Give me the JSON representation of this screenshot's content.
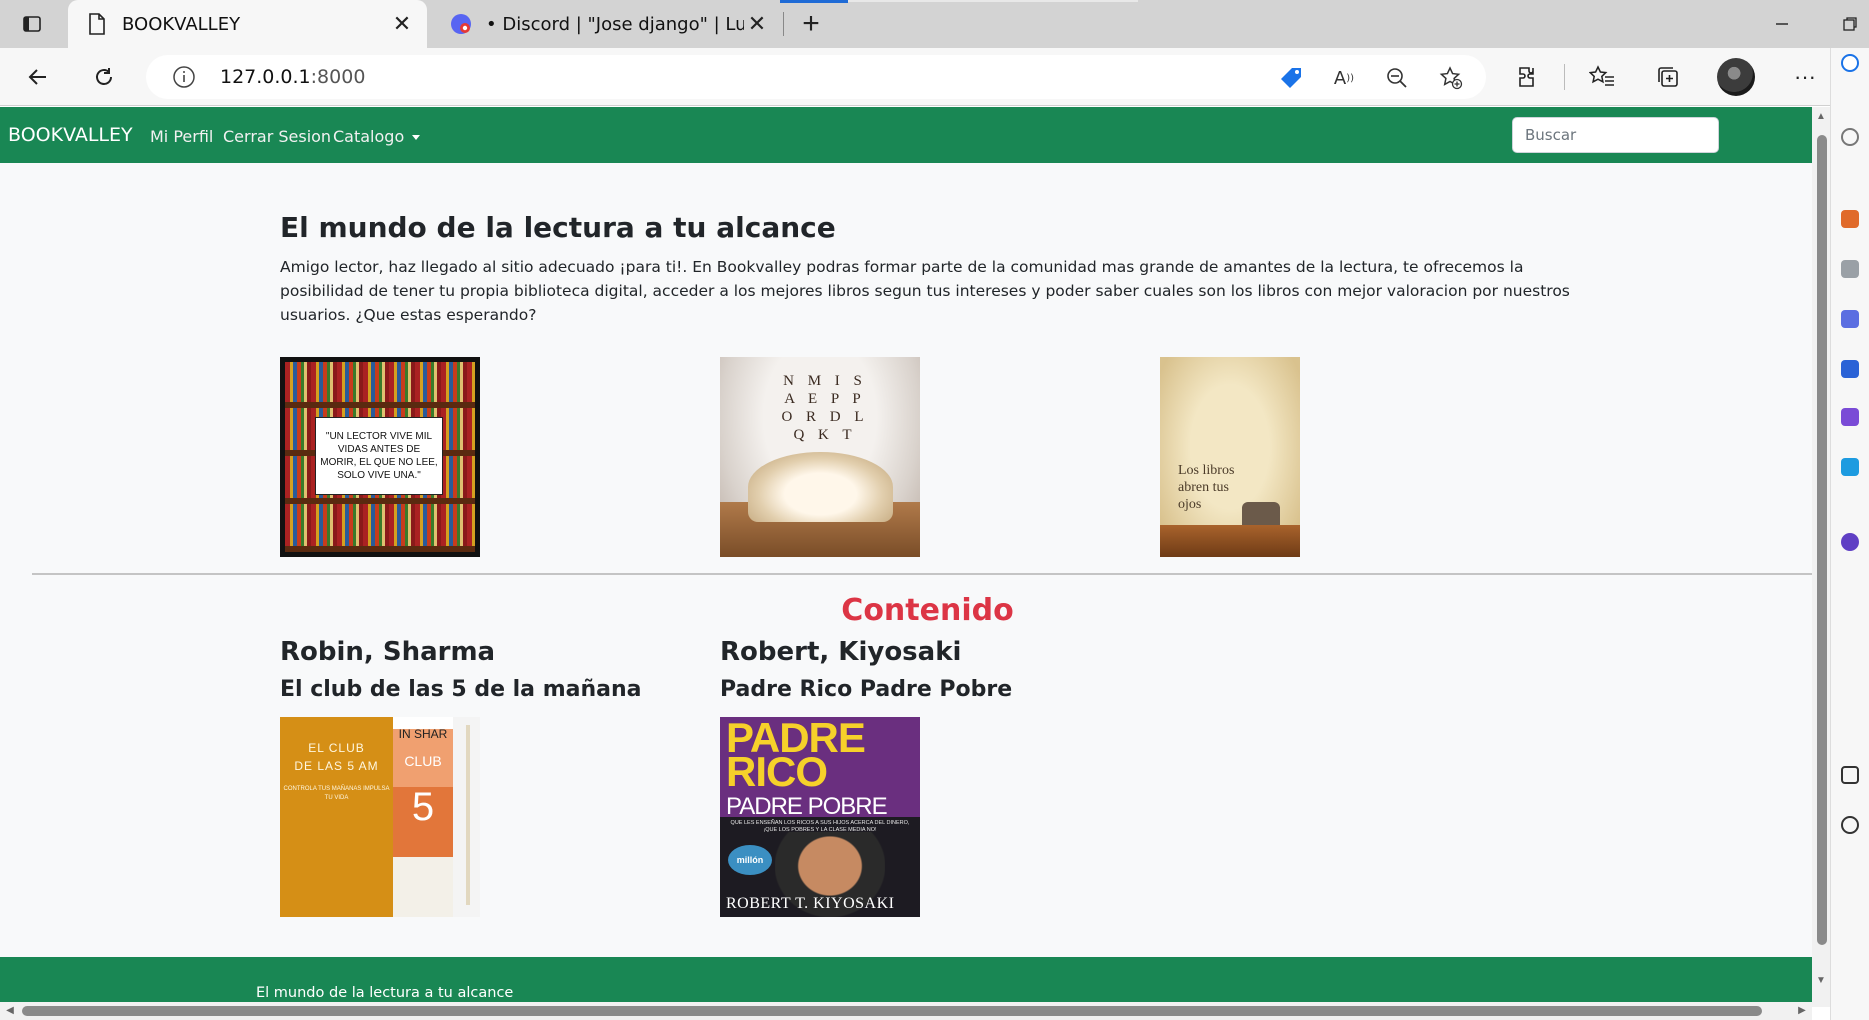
{
  "browser": {
    "tabs": [
      {
        "title": "BOOKVALLEY",
        "active": true,
        "icon": "page-icon"
      },
      {
        "title": "• Discord | \"Jose django\" | Lumet",
        "active": false,
        "icon": "discord-icon"
      }
    ],
    "address": {
      "host": "127.0.0.1",
      "port": ":8000"
    }
  },
  "navbar": {
    "brand": "BOOKVALLEY",
    "links": [
      "Mi Perfil",
      "Cerrar Sesion",
      "Catalogo"
    ],
    "search_placeholder": "Buscar"
  },
  "hero": {
    "title": "El mundo de la lectura a tu alcance",
    "text": "Amigo lector, haz llegado al sitio adecuado ¡para ti!. En Bookvalley podras formar parte de la comunidad mas grande de amantes de la lectura, te ofrecemos la posibilidad de tener tu propia biblioteca digital, acceder a los mejores libros segun tus intereses y poder saber cuales son los libros con mejor valoracion por nuestros usuarios. ¿Que estas esperando?"
  },
  "gallery": {
    "quote": "\"UN LECTOR VIVE MIL VIDAS ANTES DE MORIR, EL QUE NO LEE, SOLO VIVE UNA.\"",
    "letters": "N M I S A E P P O R D L Q K T",
    "libros": "Los libros abren tus ojos"
  },
  "content": {
    "title": "Contenido",
    "books": [
      {
        "author": "Robin, Sharma",
        "title": "El club de las 5 de la mañana",
        "cover": {
          "line1": "EL CLUB",
          "line2": "DE LAS 5 AM",
          "sub": "CONTROLA TUS MAÑANAS IMPULSA TU VIDA",
          "spine": "IN SHAR",
          "club": "CLUB",
          "num": "5"
        }
      },
      {
        "author": "Robert, Kiyosaki",
        "title": "Padre Rico Padre Pobre",
        "cover": {
          "line1": "PADRE",
          "line2": "RICO",
          "line3": "PADRE POBRE",
          "sub": "QUE LES ENSEÑAN LOS RICOS A SUS HIJOS ACERCA DEL DINERO, ¡QUE LOS POBRES Y LA CLASE MEDIA NO!",
          "badge": "millón",
          "author": "ROBERT T. KIYOSAKI"
        }
      }
    ]
  },
  "footer": {
    "text": "El mundo de la lectura a tu alcance"
  },
  "colors": {
    "navbar": "#198754",
    "accent": "#dc3545"
  }
}
